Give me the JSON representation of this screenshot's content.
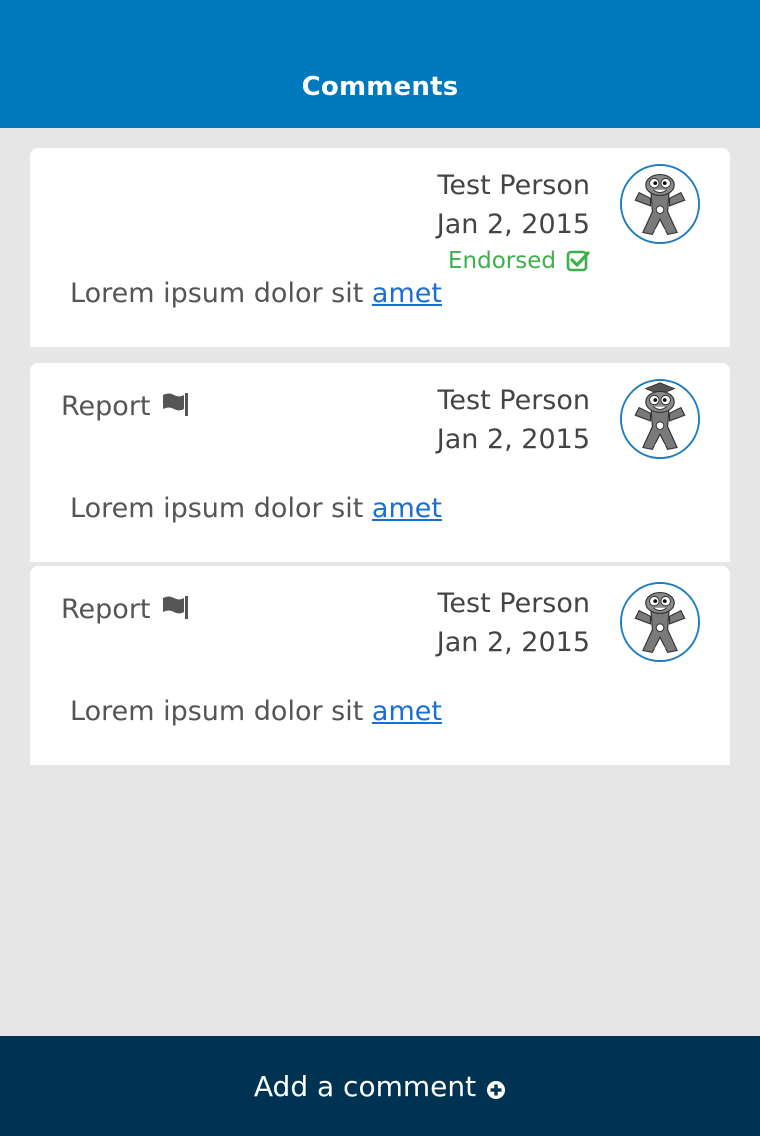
{
  "header": {
    "title": "Comments"
  },
  "comments": [
    {
      "author": "Test Person",
      "date": "Jan 2, 2015",
      "endorsed_label": "Endorsed",
      "report_label": "",
      "text": "Lorem ipsum dolor sit ",
      "link": "amet"
    },
    {
      "author": "Test Person",
      "date": "Jan 2, 2015",
      "endorsed_label": "",
      "report_label": "Report",
      "text": "Lorem ipsum dolor sit ",
      "link": "amet"
    },
    {
      "author": "Test Person",
      "date": "Jan 2, 2015",
      "endorsed_label": "",
      "report_label": "Report",
      "text": "Lorem ipsum dolor sit ",
      "link": "amet"
    }
  ],
  "footer": {
    "add_label": "Add a comment"
  },
  "colors": {
    "header": "#0079bf",
    "footer": "#003351",
    "endorsed": "#3cb04a",
    "link": "#1a6fd3"
  },
  "icons": [
    "check-square-icon",
    "flag-icon",
    "plus-circle-icon",
    "avatar-mascot"
  ]
}
